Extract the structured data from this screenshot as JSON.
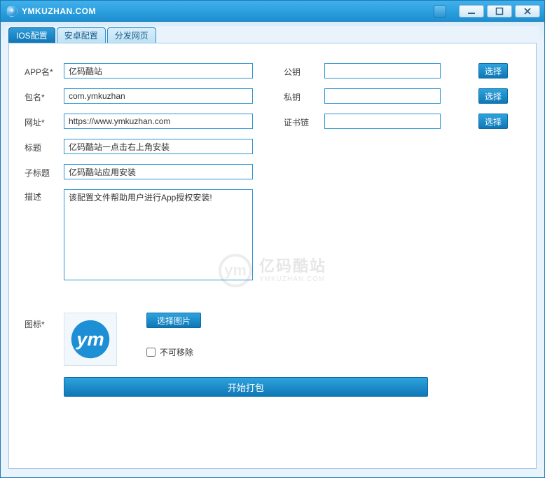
{
  "window": {
    "title": "YMKUZHAN.COM"
  },
  "tabs": [
    {
      "label": "IOS配置",
      "active": true
    },
    {
      "label": "安卓配置",
      "active": false
    },
    {
      "label": "分发网页",
      "active": false
    }
  ],
  "form": {
    "app_name_label": "APP名*",
    "app_name_value": "亿码酷站",
    "package_label": "包名*",
    "package_value": "com.ymkuzhan",
    "url_label": "网址*",
    "url_value": "https://www.ymkuzhan.com",
    "title_label": "标题",
    "title_value": "亿码酷站一点击右上角安装",
    "subtitle_label": "子标题",
    "subtitle_value": "亿码酷站应用安装",
    "desc_label": "描述",
    "desc_value": "该配置文件帮助用户进行App授权安装!",
    "pubkey_label": "公钥",
    "pubkey_value": "",
    "prikey_label": "私钥",
    "prikey_value": "",
    "certchain_label": "证书链",
    "certchain_value": "",
    "select_btn": "选择",
    "icon_label": "图标*",
    "select_image_btn": "选择图片",
    "not_removable_label": "不可移除",
    "start_build_btn": "开始打包"
  },
  "watermark": {
    "cn": "亿码酷站",
    "en": "YMKUZHAN.COM"
  }
}
